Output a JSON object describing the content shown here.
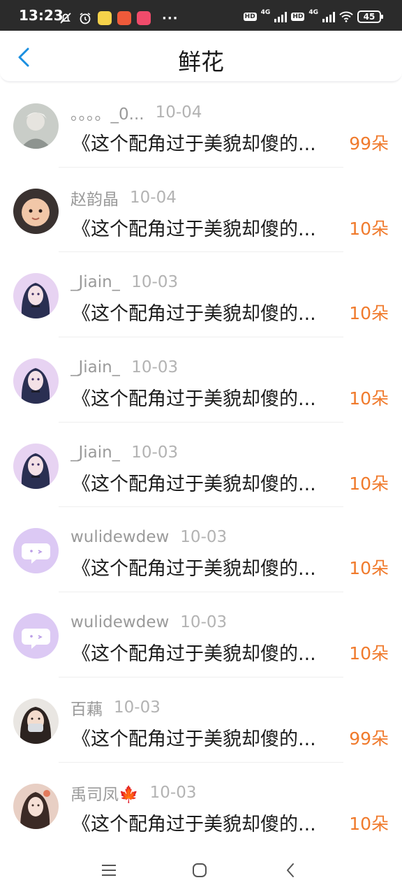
{
  "status_bar": {
    "time": "13:23",
    "more": "···",
    "hd_1": "HD",
    "net_1": "4G",
    "hd_2": "HD",
    "net_2": "4G",
    "battery": "45",
    "icons": [
      "mute-icon",
      "alarm-icon",
      "app-notification-icon",
      "app-notification-icon",
      "app-notification-icon"
    ]
  },
  "header": {
    "title": "鲜花",
    "back_icon": "chevron-left-icon"
  },
  "list": {
    "items": [
      {
        "username": "。。。。_0...",
        "date": "10-04",
        "title": "《这个配角过于美貌却傻的...",
        "flowers": "99朵"
      },
      {
        "username": "赵韵晶",
        "date": "10-04",
        "title": "《这个配角过于美貌却傻的...",
        "flowers": "10朵"
      },
      {
        "username": "_Jiain_",
        "date": "10-03",
        "title": "《这个配角过于美貌却傻的...",
        "flowers": "10朵"
      },
      {
        "username": "_Jiain_",
        "date": "10-03",
        "title": "《这个配角过于美貌却傻的...",
        "flowers": "10朵"
      },
      {
        "username": "_Jiain_",
        "date": "10-03",
        "title": "《这个配角过于美貌却傻的...",
        "flowers": "10朵"
      },
      {
        "username": "wulidewdew",
        "date": "10-03",
        "title": "《这个配角过于美貌却傻的...",
        "flowers": "10朵"
      },
      {
        "username": "wulidewdew",
        "date": "10-03",
        "title": "《这个配角过于美貌却傻的...",
        "flowers": "10朵"
      },
      {
        "username": "百藕",
        "date": "10-03",
        "title": "《这个配角过于美貌却傻的...",
        "flowers": "99朵"
      },
      {
        "username": "禹司凤🍁",
        "date": "10-03",
        "title": "《这个配角过于美貌却傻的...",
        "flowers": "10朵"
      }
    ]
  },
  "nav_bar": {
    "icons": [
      "menu-icon",
      "home-icon",
      "back-icon"
    ]
  },
  "colors": {
    "accent": "#1a8fe0",
    "flower_count": "#f07a2c",
    "status_bar_bg": "#2b2b2b",
    "username": "#9a9a9a",
    "date": "#b3b3b3"
  }
}
